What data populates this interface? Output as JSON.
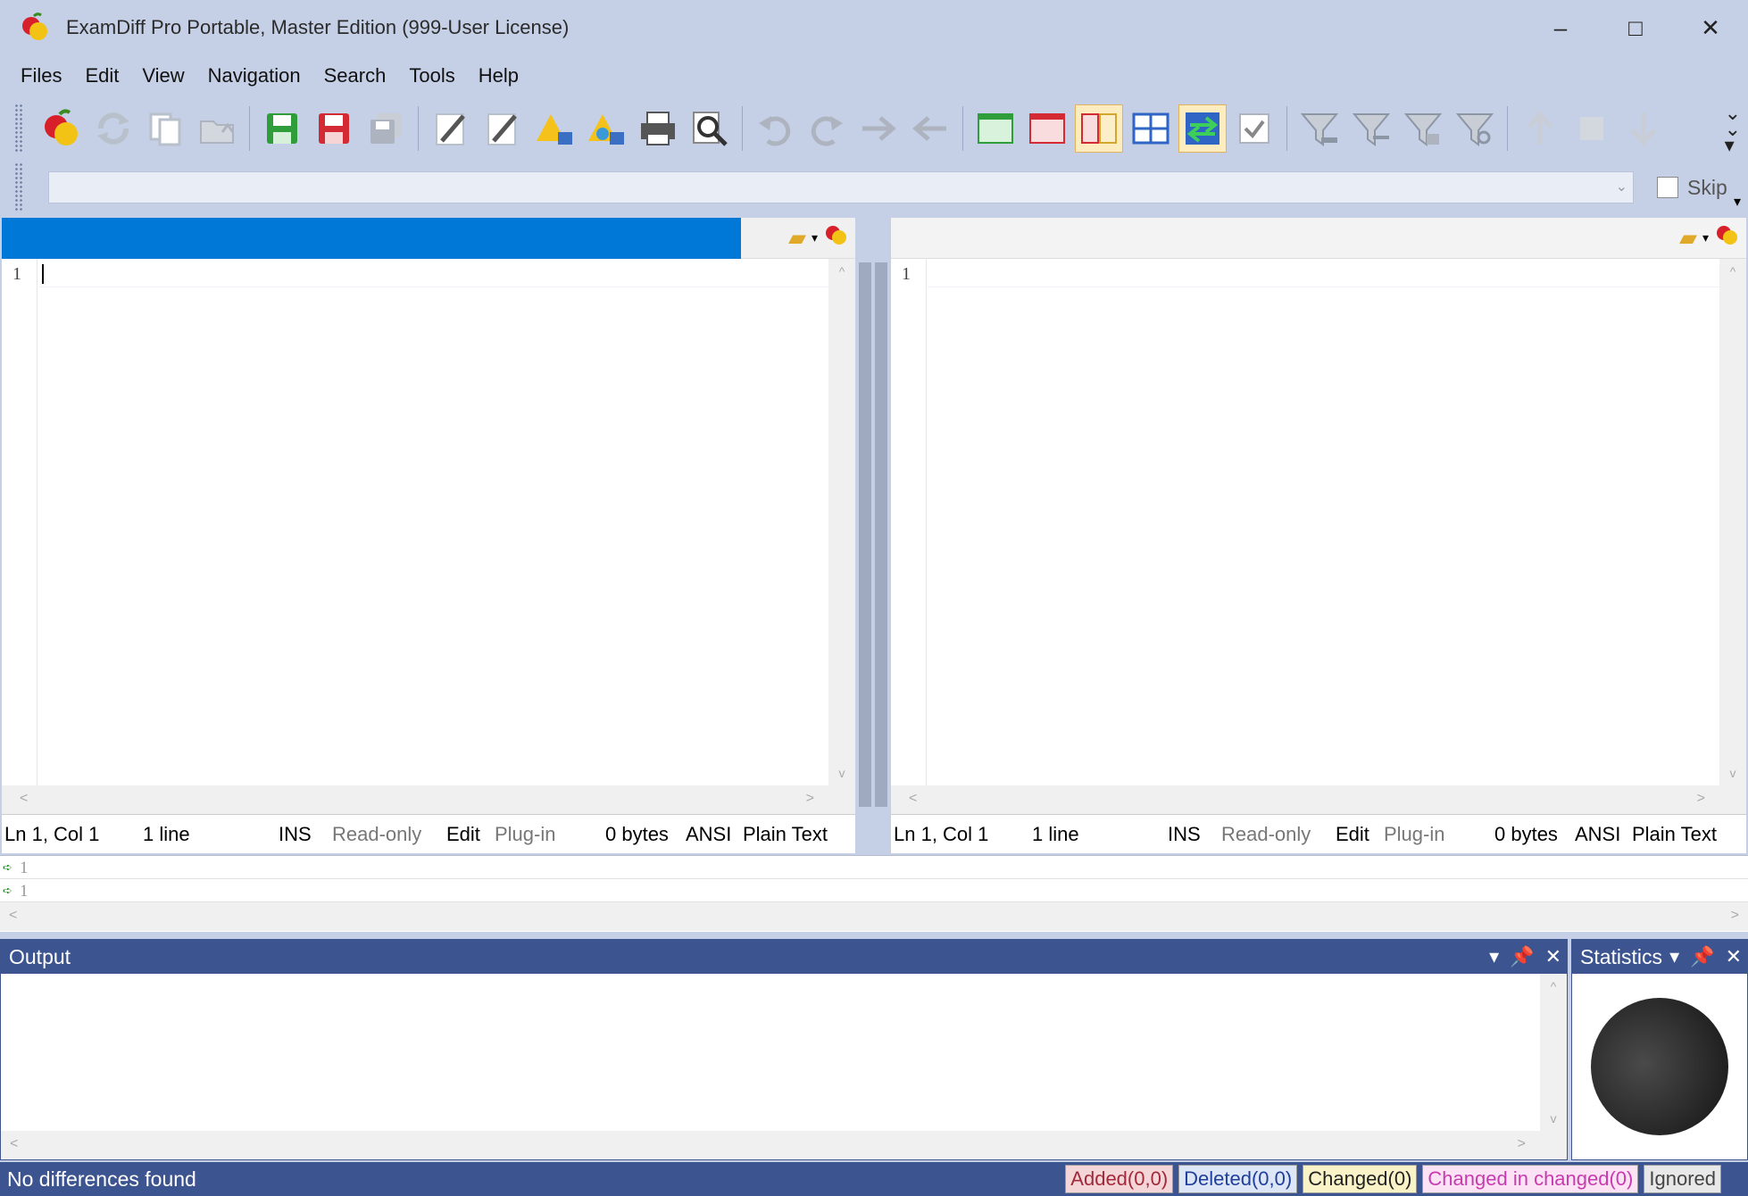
{
  "window": {
    "title": "ExamDiff Pro Portable, Master Edition (999-User License)",
    "controls": {
      "minimize": "–",
      "maximize": "□",
      "close": "✕"
    }
  },
  "menu": [
    "Files",
    "Edit",
    "View",
    "Navigation",
    "Search",
    "Tools",
    "Help"
  ],
  "toolbar": {
    "buttons": [
      {
        "name": "compare-icon",
        "glyph": "🍎"
      },
      {
        "name": "recompare-icon",
        "glyph": "⟳"
      },
      {
        "name": "swap-files-icon",
        "glyph": "⇄"
      },
      {
        "name": "open-folder-icon",
        "glyph": "📂"
      },
      {
        "name": "save-first-icon",
        "glyph": "💾"
      },
      {
        "name": "save-second-icon",
        "glyph": "💾"
      },
      {
        "name": "save-all-icon",
        "glyph": "🗐"
      },
      {
        "name": "edit-first-icon",
        "glyph": "✎"
      },
      {
        "name": "edit-second-icon",
        "glyph": "✎"
      },
      {
        "name": "create-report-icon",
        "glyph": "⚠"
      },
      {
        "name": "export-report-icon",
        "glyph": "⚠"
      },
      {
        "name": "print-icon",
        "glyph": "🖶"
      },
      {
        "name": "find-icon",
        "glyph": "🔍"
      },
      {
        "name": "undo-icon",
        "glyph": "↶"
      },
      {
        "name": "redo-icon",
        "glyph": "↷"
      },
      {
        "name": "copy-right-icon",
        "glyph": "→"
      },
      {
        "name": "copy-left-icon",
        "glyph": "←"
      },
      {
        "name": "show-added-icon",
        "glyph": "▭"
      },
      {
        "name": "show-deleted-icon",
        "glyph": "▭"
      },
      {
        "name": "show-changed-icon",
        "glyph": "◫"
      },
      {
        "name": "show-identical-icon",
        "glyph": "⊞"
      },
      {
        "name": "sync-scroll-icon",
        "glyph": "⇄"
      },
      {
        "name": "check-icon",
        "glyph": "☑"
      },
      {
        "name": "filter-icon",
        "glyph": "⏷"
      },
      {
        "name": "filter-lines-icon",
        "glyph": "⏷"
      },
      {
        "name": "filter-text-icon",
        "glyph": "⏷"
      },
      {
        "name": "filter-search-icon",
        "glyph": "⏷"
      },
      {
        "name": "prev-diff-icon",
        "glyph": "↑"
      },
      {
        "name": "current-diff-icon",
        "glyph": "■"
      },
      {
        "name": "next-diff-icon",
        "glyph": "↓"
      }
    ],
    "overflow": "»"
  },
  "searchrow": {
    "value": "",
    "skip_label": "Skip"
  },
  "left_pane": {
    "path": "",
    "line_number": "1",
    "status": {
      "position": "Ln 1, Col 1",
      "lines": "1 line",
      "mode": "INS",
      "readonly": "Read-only",
      "edit": "Edit",
      "plugin": "Plug-in",
      "size": "0 bytes",
      "encoding": "ANSI",
      "syntax": "Plain Text"
    }
  },
  "right_pane": {
    "path": "",
    "line_number": "1",
    "status": {
      "position": "Ln 1, Col 1",
      "lines": "1 line",
      "mode": "INS",
      "readonly": "Read-only",
      "edit": "Edit",
      "plugin": "Plug-in",
      "size": "0 bytes",
      "encoding": "ANSI",
      "syntax": "Plain Text"
    }
  },
  "nav_strip": {
    "line1": "1",
    "line2": "1"
  },
  "output_panel": {
    "title": "Output"
  },
  "statistics_panel": {
    "title": "Statistics"
  },
  "statusbar": {
    "message": "No differences found",
    "added": "Added(0,0)",
    "deleted": "Deleted(0,0)",
    "changed": "Changed(0)",
    "changed_in_changed": "Changed in changed(0)",
    "ignored": "Ignored"
  },
  "colors": {
    "chrome": "#c5d0e6",
    "panel_header": "#3c5490",
    "selection": "#0078d7",
    "added": "#a2293a",
    "deleted": "#1f3f9a",
    "changed_in_changed": "#c83bb0"
  }
}
